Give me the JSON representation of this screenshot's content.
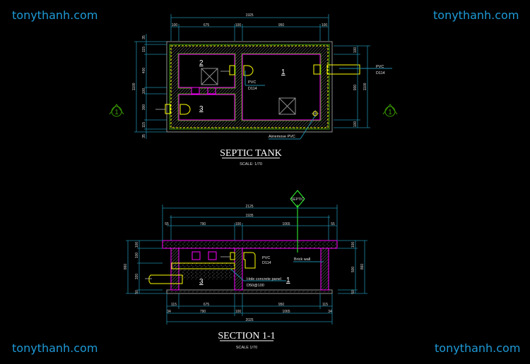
{
  "watermarks": [
    "tonythanh.com",
    "tonythanh.com",
    "tonythanh.com",
    "tonythanh.com"
  ],
  "colors": {
    "wall": "#ff00ff",
    "pipe": "#ffff00",
    "dimension": "#1e8aa8",
    "outline": "#909090",
    "marker": "#3a9a00",
    "watermark": "#1e9ad6"
  },
  "plan": {
    "title": "SEPTIC TANK",
    "scale": "SCALE: 1/70",
    "dims_top_total": "1925",
    "dims_top": [
      "100",
      "675",
      "100",
      "950",
      "100"
    ],
    "dims_left_total": "1100",
    "dims_left": [
      "35",
      "115",
      "400",
      "100",
      "300",
      "115",
      "35"
    ],
    "dims_right": [
      "100",
      "900",
      "100"
    ],
    "dims_right_total": "1100",
    "rooms": [
      "1",
      "2",
      "3"
    ],
    "pvc_label_1": "PVC",
    "pvc_size_1": "D114",
    "pvc_label_2": "PVC",
    "pvc_size_2": "D114",
    "air_label": "Airremove PVC",
    "section_marker": "1"
  },
  "section": {
    "title": "SECTION 1-1",
    "scale": "SCALE 1/70",
    "marker": "SEPTIC",
    "dims_top_total": "2125",
    "dims_top_inner": "1935",
    "dims_top": [
      "55",
      "790",
      "100",
      "1065",
      "55"
    ],
    "dims_bottom_1": [
      "115",
      "675",
      "950",
      "115"
    ],
    "dims_bottom_2": [
      "34",
      "790",
      "100",
      "1065",
      "34"
    ],
    "dims_bottom_total": "2025",
    "dims_left": [
      "100",
      "100",
      "320",
      "50"
    ],
    "dims_left_total": "860",
    "dims_right": [
      "100",
      "500",
      "50"
    ],
    "dims_right_total": "860",
    "pvc_label": "PVC",
    "pvc_size": "D114",
    "brick_label": "Brick wall",
    "panel_label": "Hole concrete panel",
    "panel_spec": "D50@100",
    "panel_num": "1",
    "room_num": "3"
  }
}
